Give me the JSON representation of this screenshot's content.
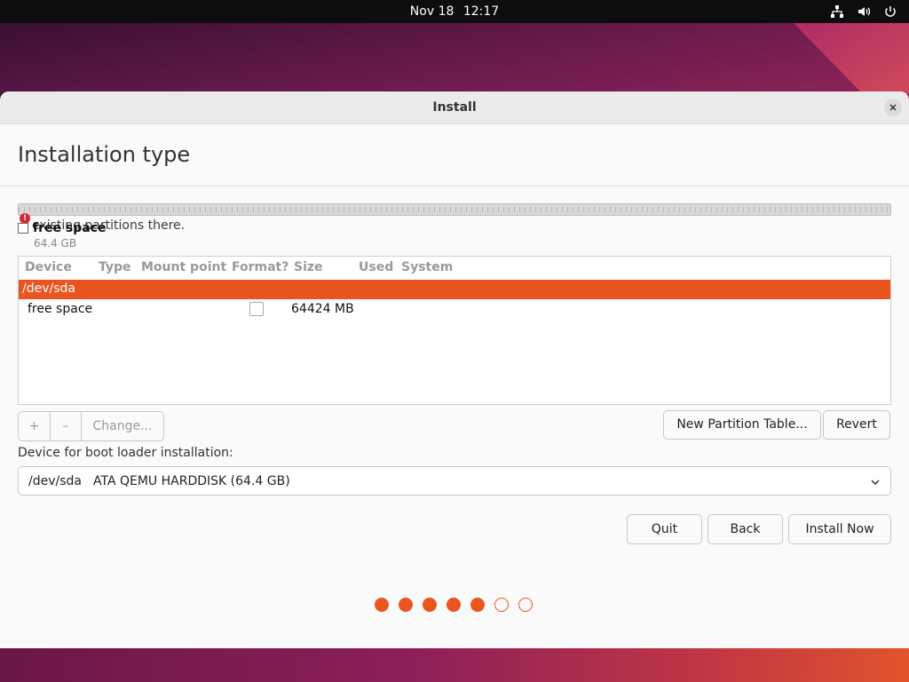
{
  "topbar": {
    "date": "Nov 18",
    "time": "12:17",
    "icons": [
      "network-icon",
      "volume-icon",
      "power-icon"
    ]
  },
  "window": {
    "title": "Install",
    "page_title": "Installation type"
  },
  "partition_bar": {
    "warning_text": "existing partitions there.",
    "legend_label": "free space",
    "legend_size": "64.4 GB"
  },
  "table": {
    "columns": [
      "Device",
      "Type",
      "Mount point",
      "Format?",
      "Size",
      "Used",
      "System"
    ],
    "rows": [
      {
        "device": "/dev/sda",
        "selected": true
      },
      {
        "device": "free space",
        "format_checked": false,
        "size": "64424 MB",
        "selected": false
      }
    ]
  },
  "toolbar": {
    "add_label": "+",
    "remove_label": "–",
    "change_label": "Change...",
    "new_table_label": "New Partition Table...",
    "revert_label": "Revert"
  },
  "bootloader": {
    "label": "Device for boot loader installation:",
    "device": "/dev/sda",
    "description": "ATA QEMU HARDDISK (64.4 GB)"
  },
  "actions": {
    "quit_label": "Quit",
    "back_label": "Back",
    "install_label": "Install Now"
  },
  "progress": {
    "total_steps": 7,
    "completed_steps": 5
  },
  "colors": {
    "accent": "#e95420",
    "topbar": "#0d0d0d"
  }
}
